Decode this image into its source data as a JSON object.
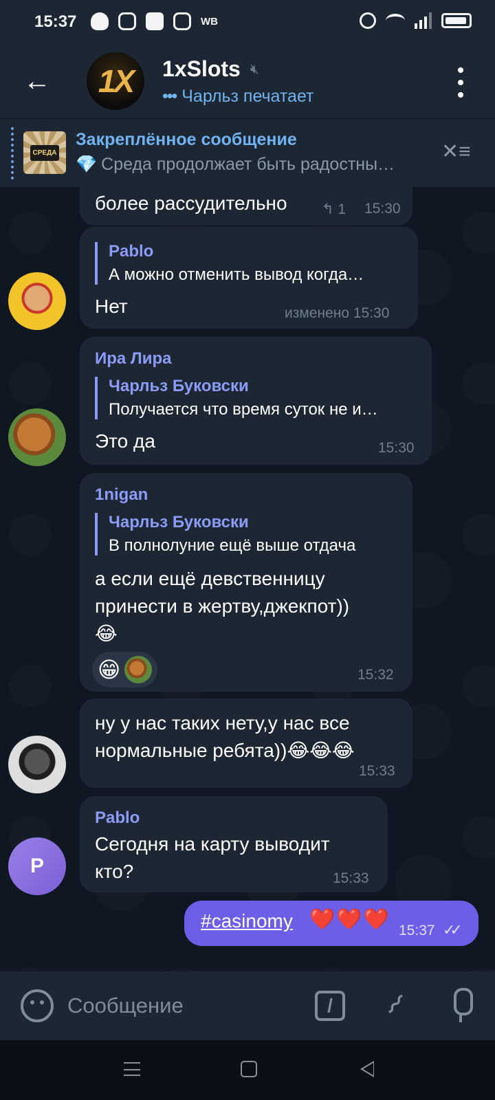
{
  "status_bar": {
    "time": "15:37",
    "carrier_text": "WB"
  },
  "header": {
    "back_icon": "arrow-left-icon",
    "channel_avatar_text": "1X",
    "title": "1xSlots",
    "muted_icon": "muted-speaker-icon",
    "typing_dots": "•••",
    "status": "Чарльз печатает",
    "menu_icon": "kebab-menu-icon"
  },
  "pinned": {
    "thumb_text": "СРЕДА",
    "title": "Закреплённое сообщение",
    "diamond": "💎",
    "text": "Среда продолжает быть радостны…",
    "unpin_icon": "unpin-icon"
  },
  "messages": [
    {
      "text": "более рассудительно",
      "reply_count": "↰ 1",
      "time": "15:30"
    },
    {
      "reply_name": "Pablo",
      "reply_text": "А можно отменить вывод когда…",
      "text": "Нет",
      "time": "изменено 15:30"
    },
    {
      "sender": "Ира Лира",
      "reply_name": "Чарльз Буковски",
      "reply_text": "Получается что время суток не и…",
      "text": "Это да",
      "time": "15:30"
    },
    {
      "sender": "1nigan",
      "reply_name": "Чарльз Буковски",
      "reply_text": "В полнолуние ещё выше отдача",
      "text_line1": "а если ещё девственницу",
      "text_line2": "принести в жертву,джекпот))",
      "text_line3": "😂",
      "reaction": "😁",
      "time": "15:32"
    },
    {
      "text_line1": "ну у нас таких нету,у нас все",
      "text_line2": "нормальные ребята))😂😂😂",
      "time": "15:33"
    },
    {
      "sender": "Pablo",
      "avatar_letter": "P",
      "text_line1": "Сегодня на карту выводит",
      "text_line2": "кто?",
      "time": "15:33"
    }
  ],
  "own_message": {
    "hashtag": "#casinomy",
    "hearts": "❤️❤️❤️",
    "time": "15:37",
    "checks": "✓✓"
  },
  "input": {
    "placeholder": "Сообщение",
    "command_label": "/"
  },
  "colors": {
    "accent": "#71b3f0",
    "own_bubble": "#6c5ee6",
    "sender_name": "#8c9bf7",
    "bubble": "#1d2733"
  }
}
